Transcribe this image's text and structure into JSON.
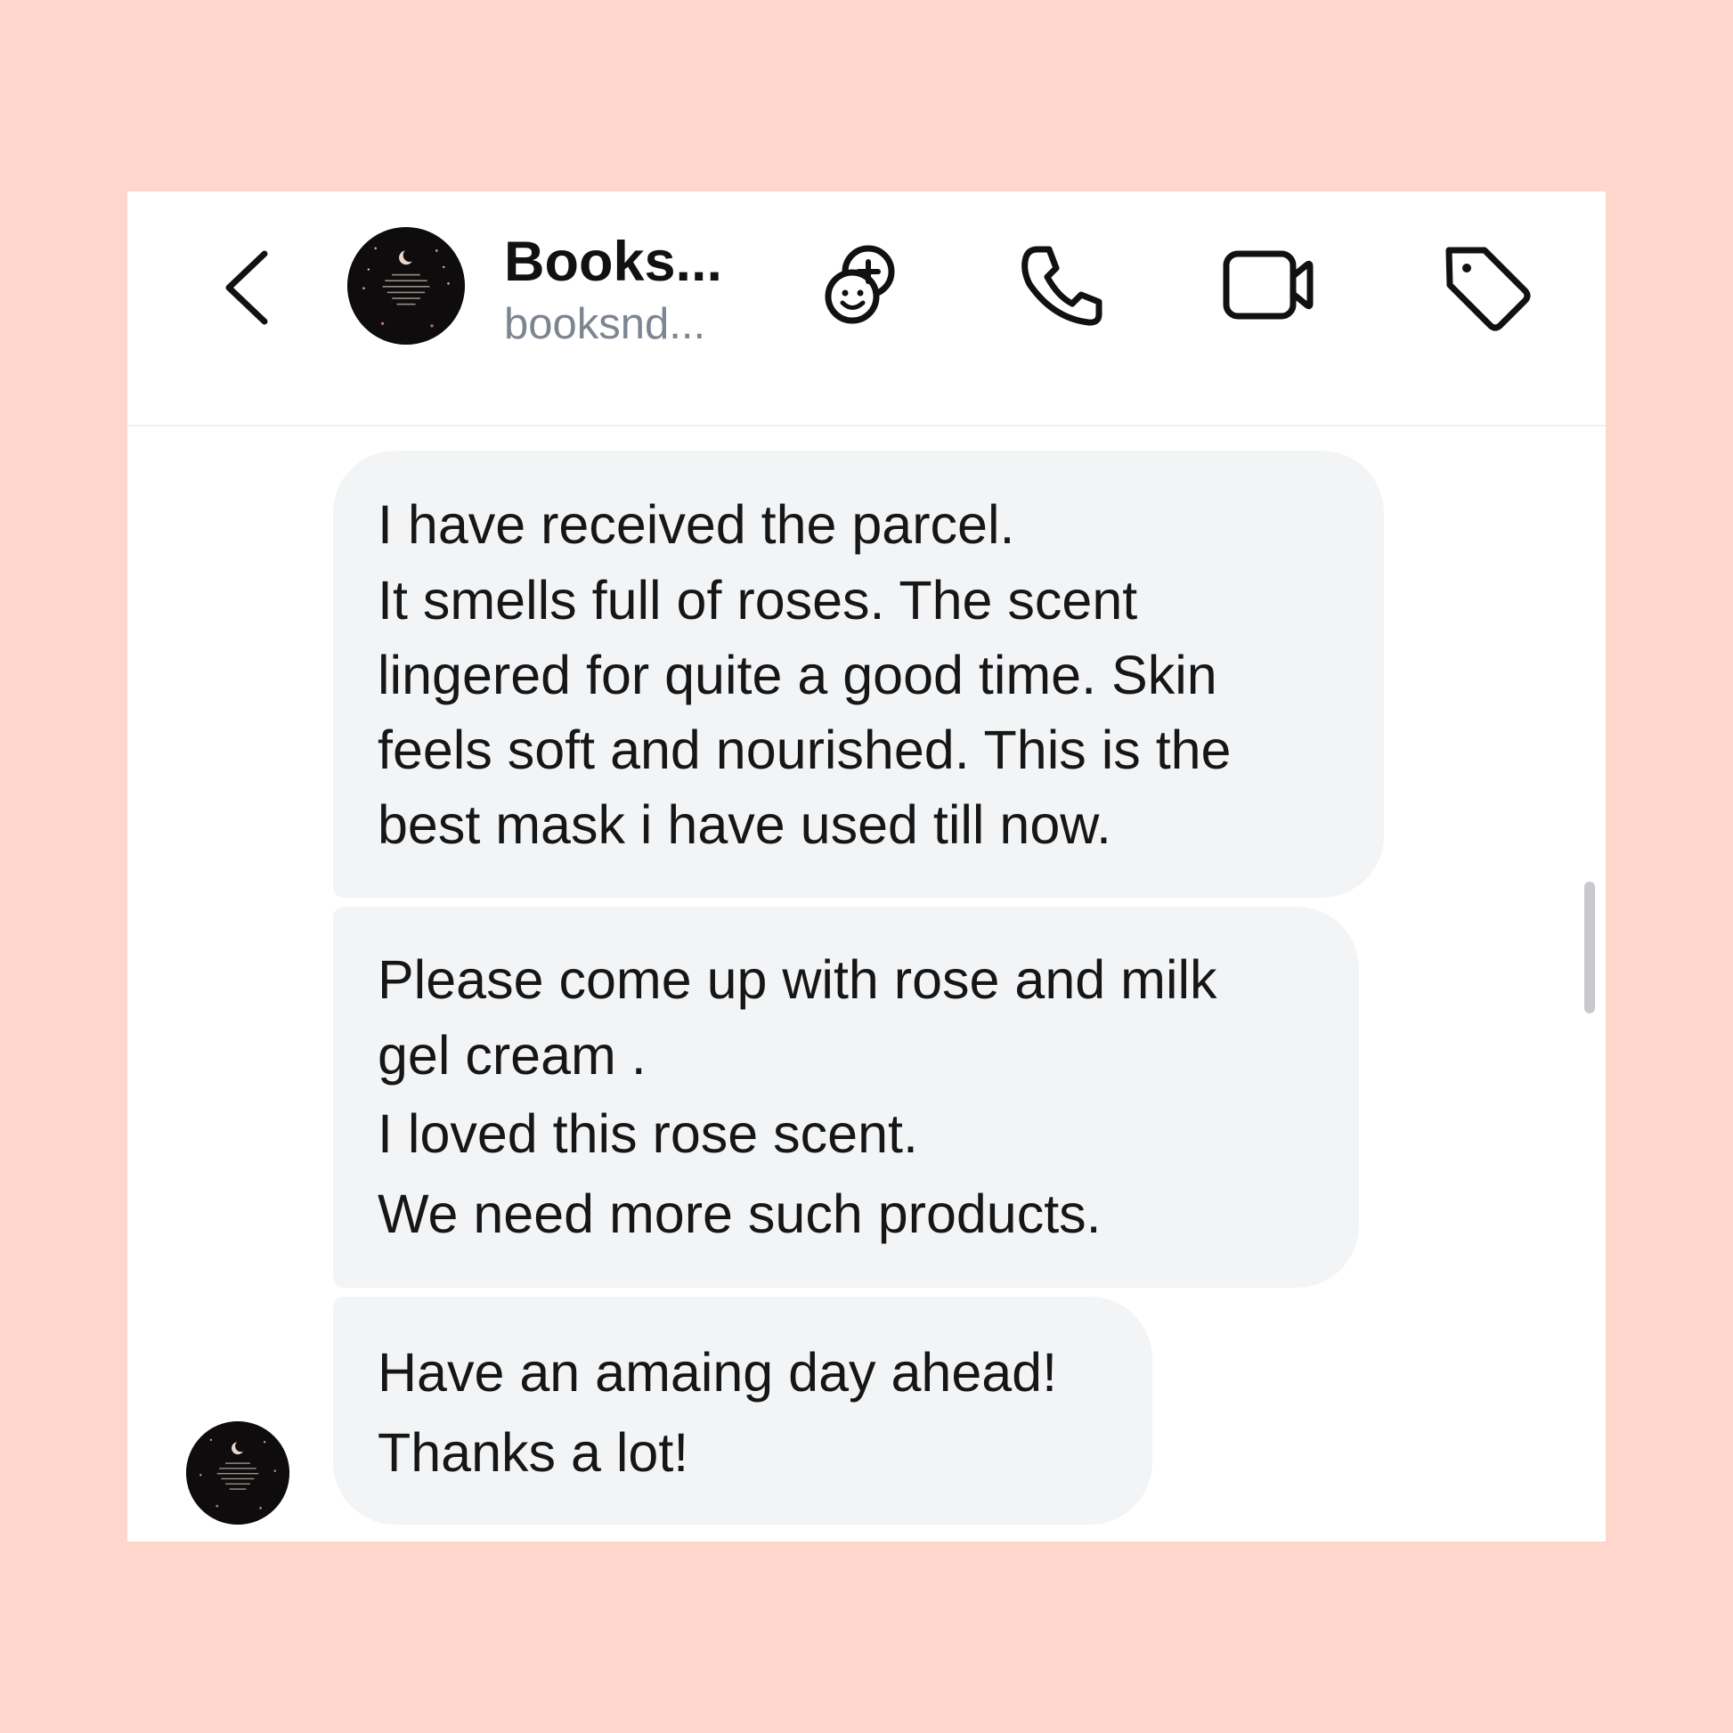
{
  "header": {
    "contact_name": "Books...",
    "contact_handle": "booksnd...",
    "icons": {
      "back": "chevron-left-icon",
      "add_people": "add-people-icon",
      "call": "phone-icon",
      "video": "video-camera-icon",
      "label": "tag-icon"
    }
  },
  "messages": [
    {
      "lines": [
        "I have received the parcel.",
        "It smells full of roses. The scent",
        "lingered for quite a good time. Skin",
        "feels soft and nourished. This is the",
        "best mask i have used till now."
      ]
    },
    {
      "lines": [
        "Please come up with rose and milk",
        "gel cream .",
        "I loved this rose scent.",
        "We need more such products."
      ]
    },
    {
      "lines": [
        "Have an amaing day ahead!",
        "Thanks a lot!"
      ]
    }
  ],
  "colors": {
    "page_background": "#ffd6cb",
    "card_background": "#ffffff",
    "bubble_background": "#f3f4f6",
    "text_primary": "#161616",
    "text_secondary": "#7d8591"
  }
}
